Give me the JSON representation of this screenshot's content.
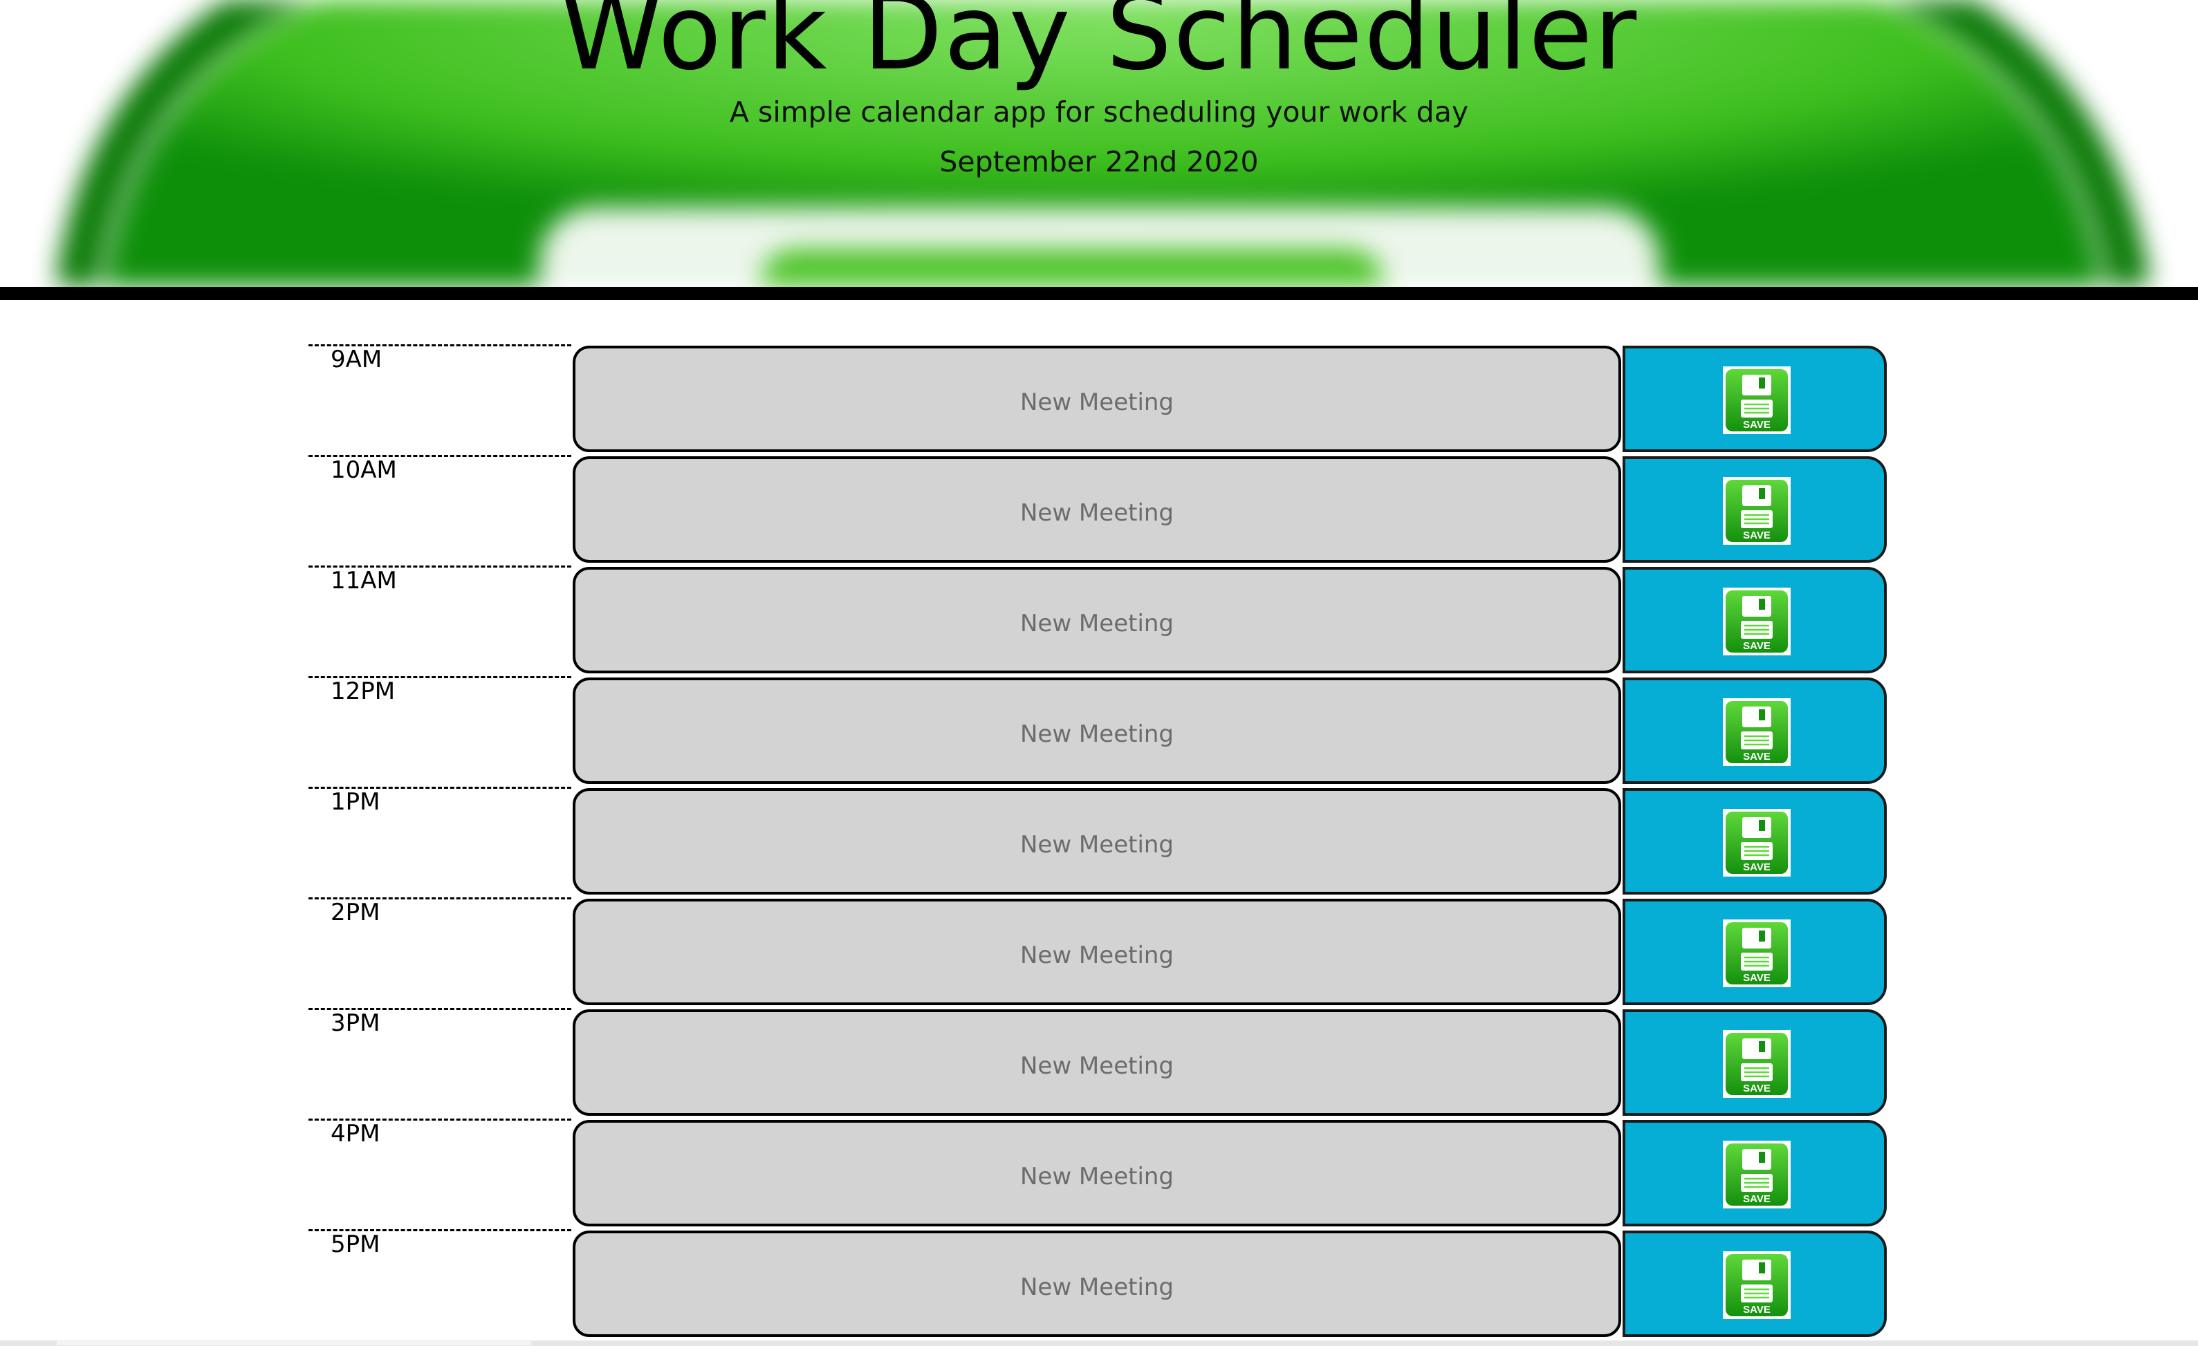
{
  "header": {
    "title": "Work Day Scheduler",
    "subtitle": "A simple calendar app for scheduling your work day",
    "date": "September 22nd 2020"
  },
  "colors": {
    "accent_green": "#4cc427",
    "save_button_blue": "#06aed5",
    "textarea_gray": "#d3d3d3"
  },
  "schedule": {
    "rows": [
      {
        "hour": "9AM",
        "placeholder": "New Meeting",
        "value": "",
        "save_icon": "save-floppy-icon"
      },
      {
        "hour": "10AM",
        "placeholder": "New Meeting",
        "value": "",
        "save_icon": "save-floppy-icon"
      },
      {
        "hour": "11AM",
        "placeholder": "New Meeting",
        "value": "",
        "save_icon": "save-floppy-icon"
      },
      {
        "hour": "12PM",
        "placeholder": "New Meeting",
        "value": "",
        "save_icon": "save-floppy-icon"
      },
      {
        "hour": "1PM",
        "placeholder": "New Meeting",
        "value": "",
        "save_icon": "save-floppy-icon"
      },
      {
        "hour": "2PM",
        "placeholder": "New Meeting",
        "value": "",
        "save_icon": "save-floppy-icon"
      },
      {
        "hour": "3PM",
        "placeholder": "New Meeting",
        "value": "",
        "save_icon": "save-floppy-icon"
      },
      {
        "hour": "4PM",
        "placeholder": "New Meeting",
        "value": "",
        "save_icon": "save-floppy-icon"
      },
      {
        "hour": "5PM",
        "placeholder": "New Meeting",
        "value": "",
        "save_icon": "save-floppy-icon"
      }
    ],
    "save_icon_label": "SAVE"
  }
}
